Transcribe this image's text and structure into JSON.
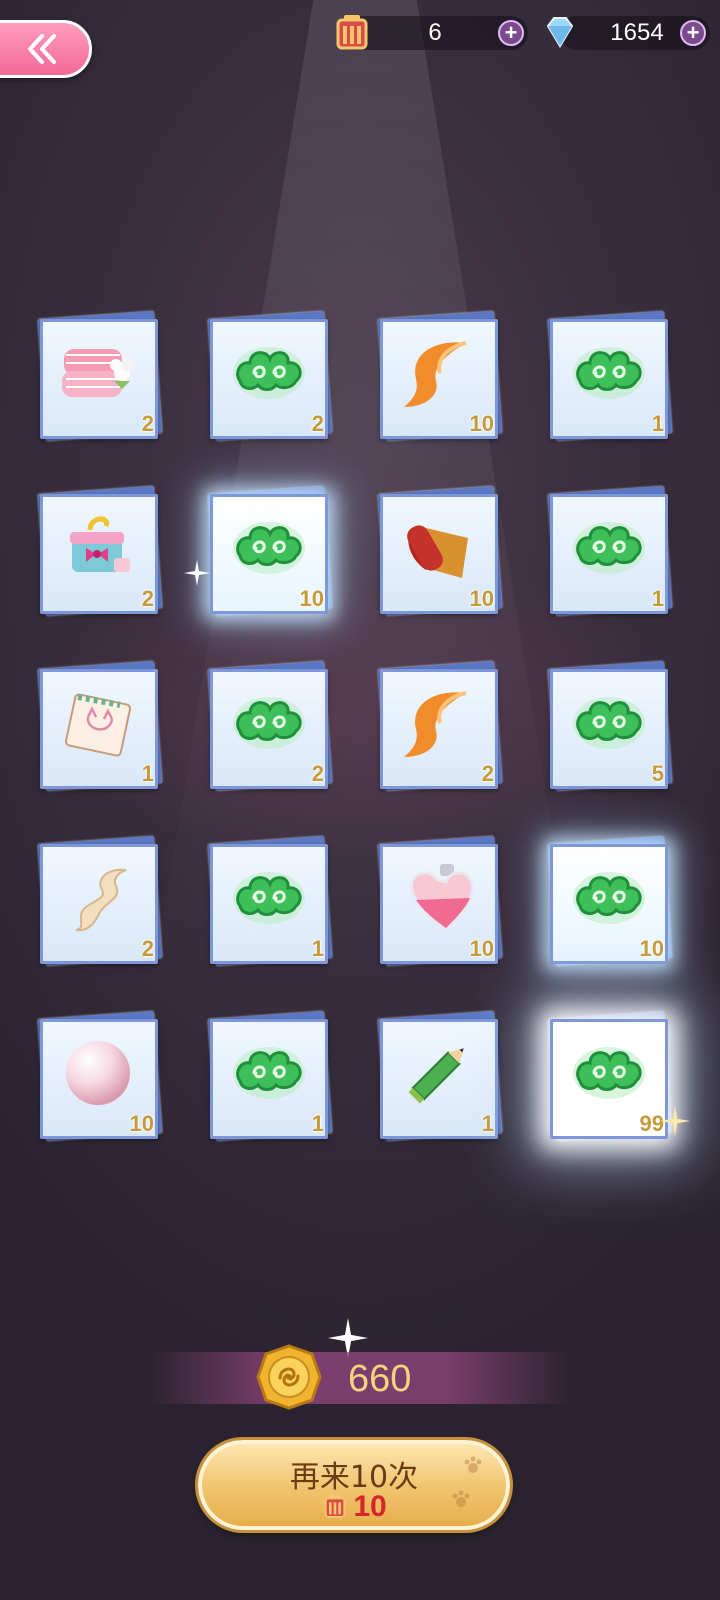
{
  "header": {
    "ticket_count": "6",
    "gem_count": "1654"
  },
  "items": [
    {
      "icon": "pink-towel-icon",
      "qty": "2"
    },
    {
      "icon": "jade-cloud-icon",
      "qty": "2"
    },
    {
      "icon": "fox-tail-icon",
      "qty": "10"
    },
    {
      "icon": "jade-cloud-icon",
      "qty": "1"
    },
    {
      "icon": "gift-box-icon",
      "qty": "2"
    },
    {
      "icon": "jade-cloud-icon",
      "qty": "10"
    },
    {
      "icon": "leather-roll-icon",
      "qty": "10"
    },
    {
      "icon": "jade-cloud-icon",
      "qty": "1"
    },
    {
      "icon": "cat-sketchpad-icon",
      "qty": "1"
    },
    {
      "icon": "jade-cloud-icon",
      "qty": "2"
    },
    {
      "icon": "fox-tail-icon",
      "qty": "2"
    },
    {
      "icon": "jade-cloud-icon",
      "qty": "5"
    },
    {
      "icon": "silk-ribbon-icon",
      "qty": "2"
    },
    {
      "icon": "jade-cloud-icon",
      "qty": "1"
    },
    {
      "icon": "heart-perfume-icon",
      "qty": "10"
    },
    {
      "icon": "jade-cloud-icon",
      "qty": "10"
    },
    {
      "icon": "pearl-icon",
      "qty": "10"
    },
    {
      "icon": "jade-cloud-icon",
      "qty": "1"
    },
    {
      "icon": "pencil-icon",
      "qty": "1"
    },
    {
      "icon": "jade-cloud-icon",
      "qty": "99"
    }
  ],
  "coins": {
    "value": "660"
  },
  "retry": {
    "label": "再来10次",
    "cost": "10"
  },
  "colors": {
    "accent_pink": "#f26a98",
    "gold": "#f7d27a",
    "cost_red": "#d7262b",
    "card_border": "#7d97d8"
  }
}
